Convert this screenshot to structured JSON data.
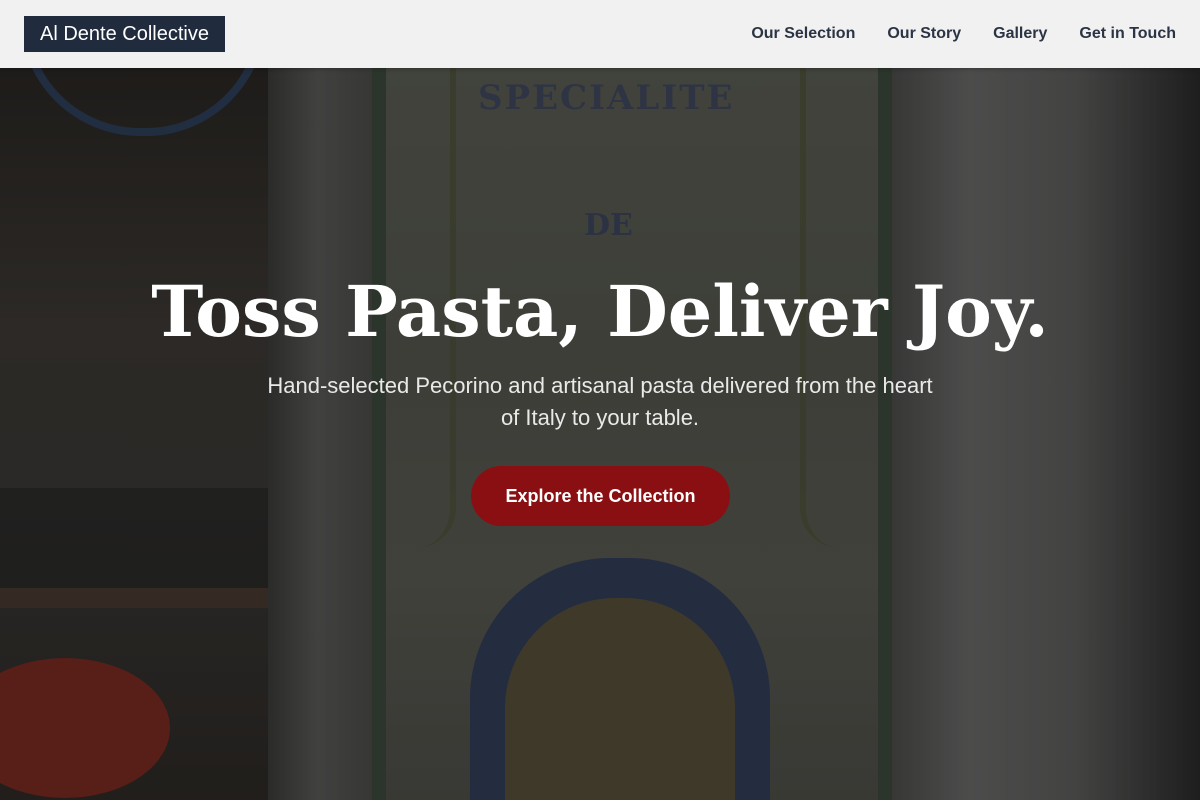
{
  "header": {
    "logo_text": "Al Dente Collective",
    "nav": [
      {
        "label": "Our Selection"
      },
      {
        "label": "Our Story"
      },
      {
        "label": "Gallery"
      },
      {
        "label": "Get in Touch"
      }
    ]
  },
  "hero": {
    "title": "Toss Pasta, Deliver Joy.",
    "subtitle": "Hand-selected Pecorino and artisanal pasta delivered from the heart of Italy to your table.",
    "cta_label": "Explore the Collection",
    "background_sign_text": [
      "SPECIALITE",
      "DE"
    ]
  },
  "colors": {
    "logo_bg": "#202b3d",
    "header_bg": "#f1f1f1",
    "nav_text": "#2b3445",
    "cta_bg": "#8a0f12"
  }
}
